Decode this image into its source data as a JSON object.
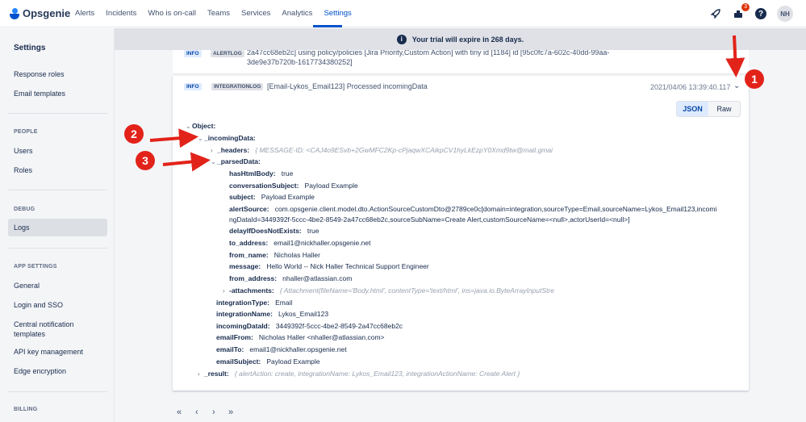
{
  "brand": {
    "name": "Opsgenie"
  },
  "nav": {
    "items": [
      "Alerts",
      "Incidents",
      "Who is on-call",
      "Teams",
      "Services",
      "Analytics",
      "Settings"
    ],
    "notifications_count": "3",
    "avatar_initials": "NH"
  },
  "sidebar": {
    "title": "Settings",
    "items_top": [
      "Response roles",
      "Email templates"
    ],
    "section_people": "PEOPLE",
    "items_people": [
      "Users",
      "Roles"
    ],
    "section_debug": "DEBUG",
    "item_logs": "Logs",
    "section_app": "APP SETTINGS",
    "items_app": [
      "General",
      "Login and SSO",
      "Central notification templates",
      "API key management",
      "Edge encryption"
    ],
    "section_billing": "BILLING"
  },
  "banner": {
    "text": "Your trial will expire in 268 days."
  },
  "prev_log": {
    "level": "INFO",
    "type": "ALERTLOG",
    "line1": "2a47cc68eb2c] using policy/policies [Jira Priority,Custom Action] with tiny id [1184] id [95c0fc7a-602c-40dd-99aa-",
    "line2": "3de9e37b720b-1617734380252]"
  },
  "log": {
    "level": "INFO",
    "type": "INTEGRATIONLOG",
    "message": "[Email-Lykos_Email123] Processed incomingData",
    "timestamp": "2021/04/06 13:39:40.117"
  },
  "view_toggle": {
    "json": "JSON",
    "raw": "Raw"
  },
  "tree": {
    "root": "Object:",
    "incoming": "_incomingData:",
    "headers_key": "_headers:",
    "headers_val": "{ MESSAGE-ID: <CAJ4o9ESvb+2GwMFC2Kp-cPjaqwXCAikpCV1hyLkEzpY0Xmd9tw@mail.gmai",
    "parsed": "_parsedData:",
    "hasHtmlBody_k": "hasHtmlBody:",
    "hasHtmlBody_v": "true",
    "conversationSubject_k": "conversationSubject:",
    "conversationSubject_v": "Payload Example",
    "subject_k": "subject:",
    "subject_v": "Payload Example",
    "alertSource_k": "alertSource:",
    "alertSource_v1": "com.opsgenie.client.model.dto.ActionSourceCustomDto@2789ce0c[domain=integration,sourceType=Email,sourceName=Lykos_Email123,incomi",
    "alertSource_v2": "ngDataId=3449392f-5ccc-4be2-8549-2a47cc68eb2c,sourceSubName=Create Alert,customSourceName=<null>,actorUserId=<null>]",
    "delay_k": "delayIfDoesNotExists:",
    "delay_v": "true",
    "to_k": "to_address:",
    "to_v": "email1@nickhaller.opsgenie.net",
    "fromname_k": "from_name:",
    "fromname_v": "Nicholas Haller",
    "message_k": "message:",
    "message_v": "Hello World -- Nick Haller Technical Support Engineer",
    "fromaddr_k": "from_address:",
    "fromaddr_v": "nhaller@atlassian.com",
    "attach_k": "-attachments:",
    "attach_v": "{ Attachment{fileName='Body.html', contentType='text/html', ins=java.io.ByteArrayInputStre",
    "itype_k": "integrationType:",
    "itype_v": "Email",
    "iname_k": "integrationName:",
    "iname_v": "Lykos_Email123",
    "idata_k": "incomingDataId:",
    "idata_v": "3449392f-5ccc-4be2-8549-2a47cc68eb2c",
    "efrom_k": "emailFrom:",
    "efrom_v": "Nicholas Haller <nhaller@atlassian.com>",
    "eto_k": "emailTo:",
    "eto_v": "email1@nickhaller.opsgenie.net",
    "esubj_k": "emailSubject:",
    "esubj_v": "Payload Example",
    "result_k": "_result:",
    "result_v": "{ alertAction: create, integrationName: Lykos_Email123, integrationActionName: Create Alert }"
  },
  "pager": {
    "first": "«",
    "prev": "‹",
    "next": "›",
    "last": "»"
  },
  "callouts": [
    "1",
    "2",
    "3"
  ],
  "colors": {
    "accent": "#0052cc",
    "callout": "#e2231a"
  }
}
